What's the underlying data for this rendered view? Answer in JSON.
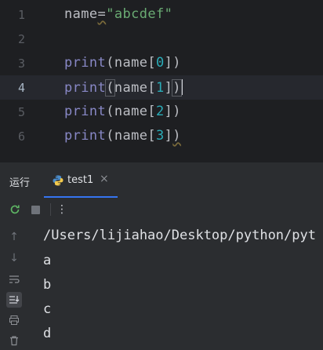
{
  "editor": {
    "lines": [
      {
        "number": "1",
        "text": "name=\"abcdef\""
      },
      {
        "number": "2",
        "text": ""
      },
      {
        "number": "3",
        "text": "print(name[0])"
      },
      {
        "number": "4",
        "text": "print(name[1])"
      },
      {
        "number": "5",
        "text": "print(name[2])"
      },
      {
        "number": "6",
        "text": "print(name[3])"
      }
    ],
    "current_line": "4",
    "l1": {
      "name": "name",
      "eq": "=",
      "str": "\"abcdef\""
    },
    "print_kw": "print",
    "idx": [
      "0",
      "1",
      "2",
      "3"
    ]
  },
  "run_panel": {
    "title": "运行",
    "tab": {
      "label": "test1",
      "close": "×"
    },
    "actions": {
      "rerun": "rerun-icon",
      "stop": "stop-icon",
      "more": "⋮"
    },
    "sidebar_icons": [
      "up-arrow-icon",
      "down-arrow-icon",
      "soft-wrap-icon",
      "scroll-to-end-icon",
      "print-icon",
      "trash-icon"
    ],
    "output": [
      "/Users/lijiahao/Desktop/python/pyt",
      "a",
      "b",
      "c",
      "d"
    ]
  },
  "colors": {
    "editor_bg": "#1e1f22",
    "panel_bg": "#2b2d30",
    "keyword": "#8888c6",
    "string": "#6aab73",
    "number": "#2aacb8",
    "accent": "#3574f0"
  }
}
